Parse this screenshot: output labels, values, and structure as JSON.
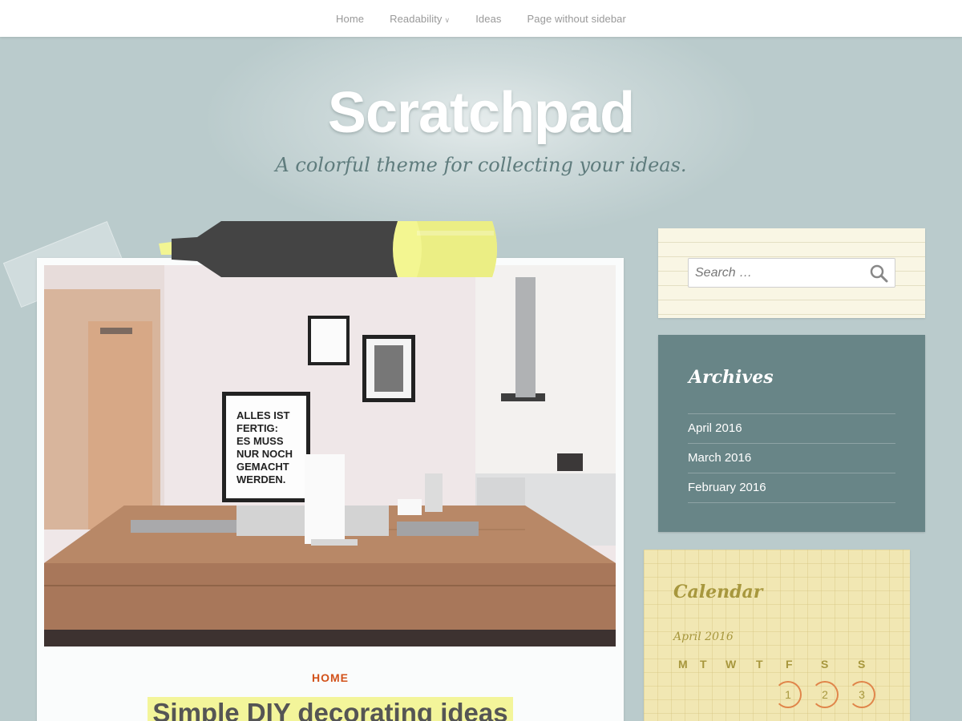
{
  "nav": {
    "items": [
      {
        "label": "Home"
      },
      {
        "label": "Readability",
        "has_submenu": true
      },
      {
        "label": "Ideas"
      },
      {
        "label": "Page without sidebar"
      }
    ]
  },
  "header": {
    "title": "Scratchpad",
    "tagline": "A colorful theme for collecting your ideas."
  },
  "post": {
    "image_icon": "desk-photo",
    "image_text": "ALLES IST FERTIG: ES MUSS NUR NOCH GEMACHT WERDEN.",
    "category": "HOME",
    "title": "Simple DIY decorating ideas"
  },
  "sidebar": {
    "search": {
      "placeholder": "Search …"
    },
    "archives": {
      "title": "Archives",
      "items": [
        "April 2016",
        "March 2016",
        "February 2016"
      ]
    },
    "calendar": {
      "title": "Calendar",
      "caption": "April 2016",
      "weekdays": [
        "M",
        "T",
        "W",
        "T",
        "F",
        "S",
        "S"
      ],
      "visible_days": [
        "1",
        "2",
        "3"
      ]
    }
  },
  "colors": {
    "background": "#bacbcc",
    "category_accent": "#d2521a",
    "title_highlight": "#f3f59a",
    "archives_bg": "#688587",
    "calendar_bg": "#f1e7b3",
    "calendar_circle": "#e0854a"
  }
}
